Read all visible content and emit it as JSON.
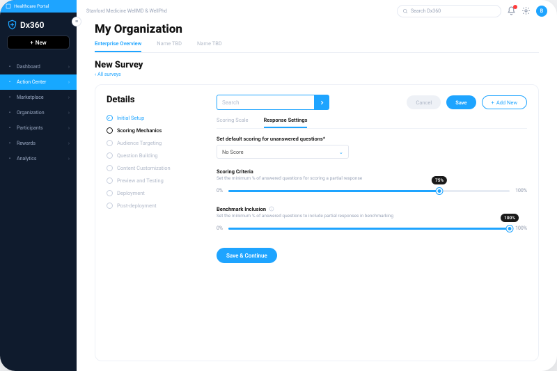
{
  "sidebar": {
    "portal_label": "Healthcare Portal",
    "product": "Dx360",
    "new_btn": "New",
    "items": [
      {
        "icon": "home",
        "label": "Dashboard"
      },
      {
        "icon": "bolt",
        "label": "Action Center",
        "active": true
      },
      {
        "icon": "bag",
        "label": "Marketplace"
      },
      {
        "icon": "org",
        "label": "Organization"
      },
      {
        "icon": "users",
        "label": "Participants"
      },
      {
        "icon": "gift",
        "label": "Rewards"
      },
      {
        "icon": "chart",
        "label": "Analytics"
      }
    ]
  },
  "topbar": {
    "breadcrumb": "Stanford Medicine WellMD & WellPhd",
    "search_placeholder": "Search Dx360",
    "avatar_initial": "B"
  },
  "page": {
    "title": "My Organization",
    "tabs": [
      "Enterprise Overview",
      "Name TBD",
      "Name TBD"
    ],
    "active_tab": 0,
    "section_title": "New Survey",
    "back_label": "All surveys"
  },
  "details": {
    "heading": "Details",
    "search_placeholder": "Search",
    "buttons": {
      "cancel": "Cancel",
      "save": "Save",
      "addnew": "Add New"
    },
    "steps": [
      {
        "label": "Initial Setup",
        "state": "done"
      },
      {
        "label": "Scoring Mechanics",
        "state": "current"
      },
      {
        "label": "Audience Targeting",
        "state": "pending"
      },
      {
        "label": "Question Building",
        "state": "pending"
      },
      {
        "label": "Content Customization",
        "state": "pending"
      },
      {
        "label": "Preview and Testing",
        "state": "pending"
      },
      {
        "label": "Deployment",
        "state": "pending"
      },
      {
        "label": "Post-deployment",
        "state": "pending"
      }
    ],
    "subtabs": [
      "Scoring Scale",
      "Response Settings"
    ],
    "active_subtab": 1,
    "default_scoring": {
      "label": "Set default scoring for unanswered questions*",
      "value": "No Score"
    },
    "criteria": {
      "title": "Scoring Criteria",
      "help": "Set the minimum % of answered questions for scoring a partial response",
      "min_label": "0%",
      "max_label": "100%",
      "value_label": "75%",
      "value_pct": 75
    },
    "benchmark": {
      "title": "Benchmark Inclusion",
      "help": "Set the minimum % of answered questions to include partial responses in benchmarking",
      "min_label": "0%",
      "max_label": "100%",
      "value_label": "100%",
      "value_pct": 100
    },
    "save_continue": "Save & Continue"
  }
}
